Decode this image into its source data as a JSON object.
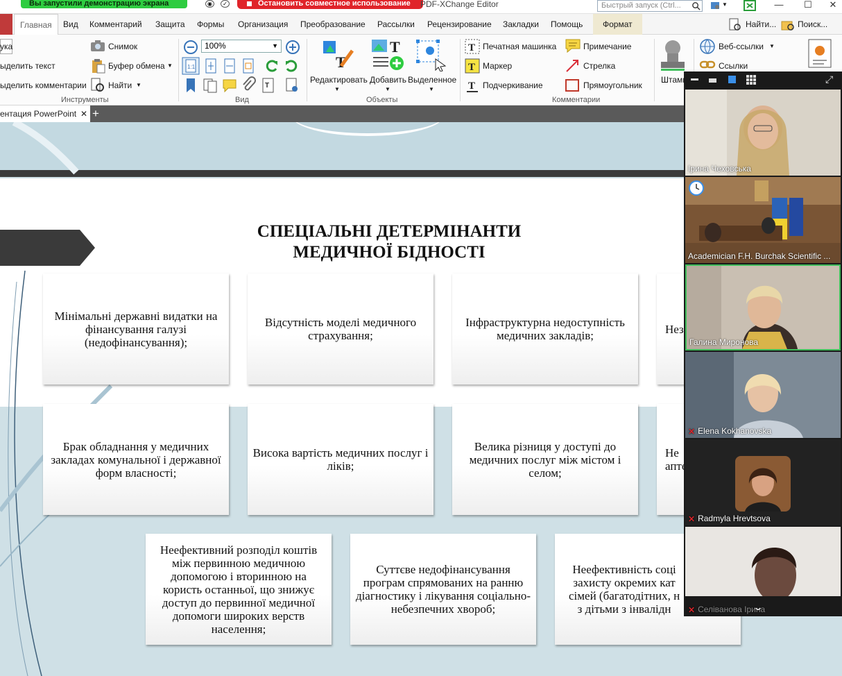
{
  "topbar": {
    "share_banner": "Вы запустили демонстрацию экрана",
    "stop_share": "Остановить совместное использование",
    "app_title": "PDF-XChange Editor",
    "quick_launch_placeholder": "Быстрый запуск (Ctrl..."
  },
  "menu": {
    "tabs": [
      "Главная",
      "Вид",
      "Комментарий",
      "Защита",
      "Формы",
      "Организация",
      "Преобразование",
      "Рассылки",
      "Рецензирование",
      "Закладки",
      "Помощь",
      "Формат"
    ],
    "right_find": "Найти...",
    "right_search": "Поиск..."
  },
  "ribbon": {
    "tools_left": [
      "ука",
      "ыделить текст",
      "ыделить комментарии"
    ],
    "snapshot": "Снимок",
    "clipboard": "Буфер обмена",
    "find": "Найти",
    "tools_group": "Инструменты",
    "zoom_value": "100%",
    "view_group": "Вид",
    "edit": "Редактировать",
    "add": "Добавить",
    "selected": "Выделенное",
    "objects_group": "Объекты",
    "typewriter": "Печатная машинка",
    "marker": "Маркер",
    "underline": "Подчеркивание",
    "note": "Примечание",
    "arrow": "Стрелка",
    "rectangle": "Прямоугольник",
    "comments_group": "Комментарии",
    "stamps": "Штамп",
    "web_links": "Веб-ссылки",
    "links": "Ссылки"
  },
  "doc_tab": {
    "title": "ентация PowerPoint"
  },
  "slide": {
    "title_line1": "СПЕЦІАЛЬНІ ДЕТЕРМІНАНТИ",
    "title_line2": "МЕДИЧНОЇ БІДНОСТІ",
    "boxes": [
      "Мінімальні державні видатки на фінансування галузі (недофінансування);",
      "Відсутність моделі медичного страхування;",
      "Інфраструктурна недоступність медичних закладів;",
      "Нез",
      "Брак обладнання у медичних закладах комунальної і державної форм власності;",
      "Висока вартість медичних послуг і ліків;",
      "Велика різниця у доступі до медичних послуг між містом і селом;",
      "Не\nапте",
      "Неефективний розподіл коштів між первинною медичною допомогою і вторинною на користь останньої, що знижує доступ до первинної медичної допомоги широких верств населення;",
      "Суттєве недофінансування програм спрямованих на ранню діагностику і лікування соціально-небезпечних хвороб;",
      "Неефективність соці\nзахисту окремих кат\nсімей (багатодітних, н\nз дітьми з інвалідн"
    ]
  },
  "participants": [
    {
      "name": "Ірина Чеховська",
      "muted": false
    },
    {
      "name": "Academician F.H. Burchak Scientific ...",
      "muted": false
    },
    {
      "name": "Галина Миронова",
      "muted": false
    },
    {
      "name": "Elena Kokhanovska",
      "muted": true
    },
    {
      "name": "Radmyla Hrevtsova",
      "muted": true
    },
    {
      "name": "Селіванова Ірина",
      "muted": true
    }
  ]
}
